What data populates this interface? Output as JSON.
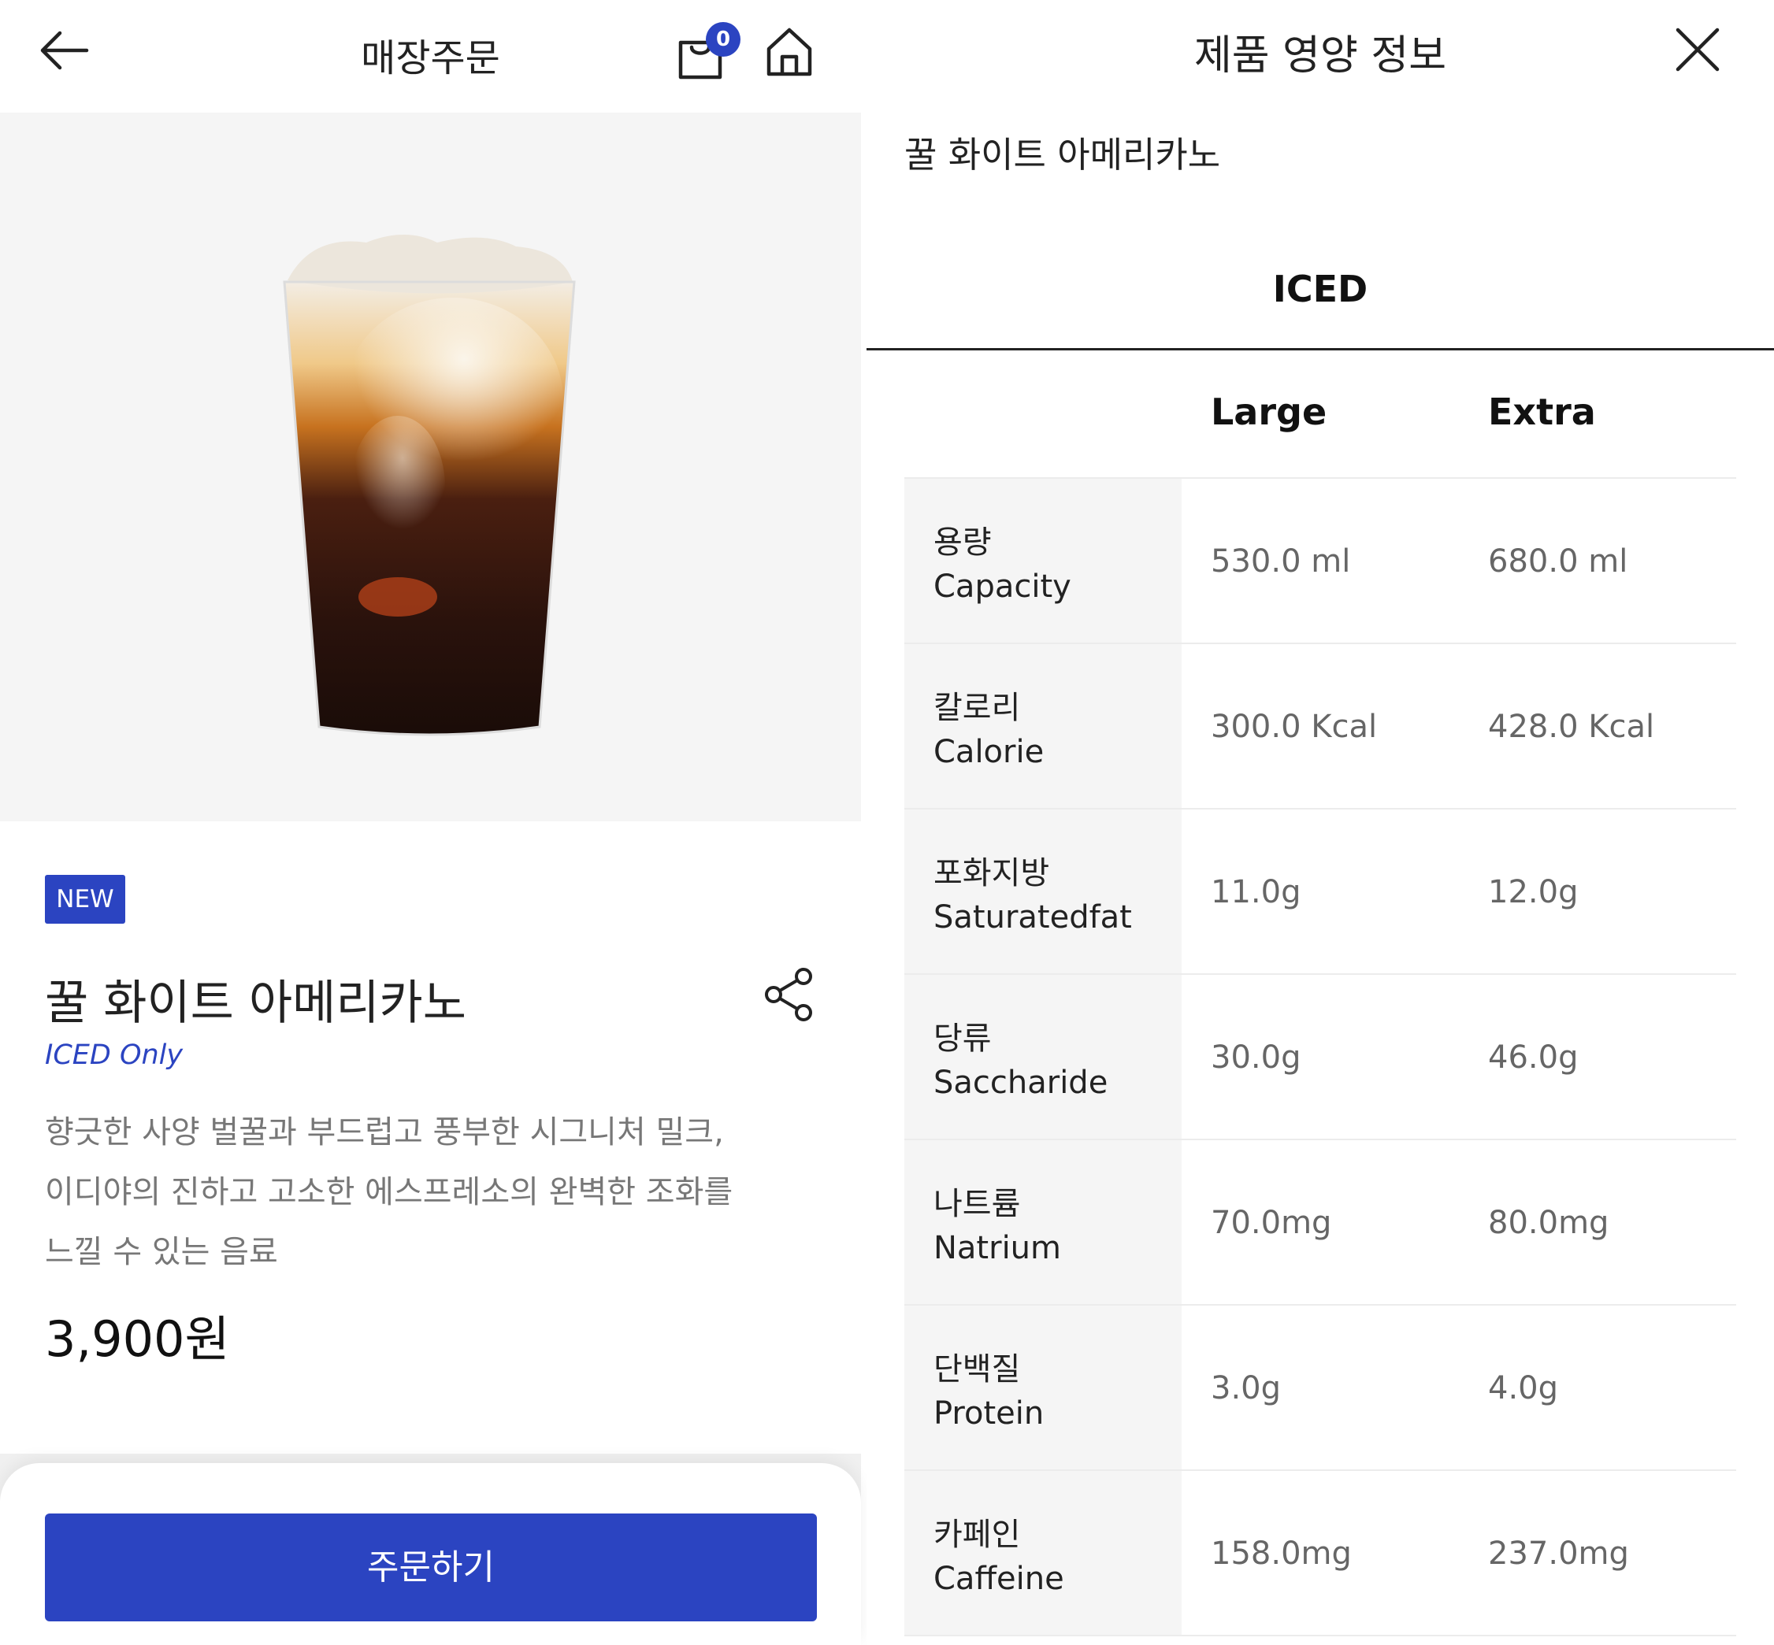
{
  "order_screen": {
    "header": {
      "title": "매장주문",
      "cart_count": "0"
    },
    "product": {
      "badge": "NEW",
      "name": "꿀 화이트 아메리카노",
      "temperature_note": "ICED Only",
      "description_lines": [
        "향긋한 사양 벌꿀과 부드럽고 풍부한 시그니처 밀크,",
        "이디야의 진하고 고소한 에스프레소의 완벽한 조화를",
        "느낄 수 있는 음료"
      ],
      "price": "3,900원"
    },
    "order_button": "주문하기"
  },
  "nutrition_screen": {
    "title": "제품 영양 정보",
    "product_name": "꿀 화이트 아메리카노",
    "tab": "ICED",
    "columns": [
      "Large",
      "Extra"
    ],
    "rows": [
      {
        "ko": "용량",
        "en": "Capacity",
        "large": "530.0 ml",
        "extra": "680.0 ml"
      },
      {
        "ko": "칼로리",
        "en": "Calorie",
        "large": "300.0 Kcal",
        "extra": "428.0 Kcal"
      },
      {
        "ko": "포화지방",
        "en": "Saturatedfat",
        "large": "11.0g",
        "extra": "12.0g"
      },
      {
        "ko": "당류",
        "en": "Saccharide",
        "large": "30.0g",
        "extra": "46.0g"
      },
      {
        "ko": "나트륨",
        "en": "Natrium",
        "large": "70.0mg",
        "extra": "80.0mg"
      },
      {
        "ko": "단백질",
        "en": "Protein",
        "large": "3.0g",
        "extra": "4.0g"
      },
      {
        "ko": "카페인",
        "en": "Caffeine",
        "large": "158.0mg",
        "extra": "237.0mg"
      }
    ]
  },
  "colors": {
    "brand_blue": "#2b44c1",
    "label_bg": "#f5f5f5"
  },
  "icons": [
    "back-arrow-icon",
    "shopping-bag-icon",
    "home-icon",
    "share-icon",
    "close-icon"
  ]
}
